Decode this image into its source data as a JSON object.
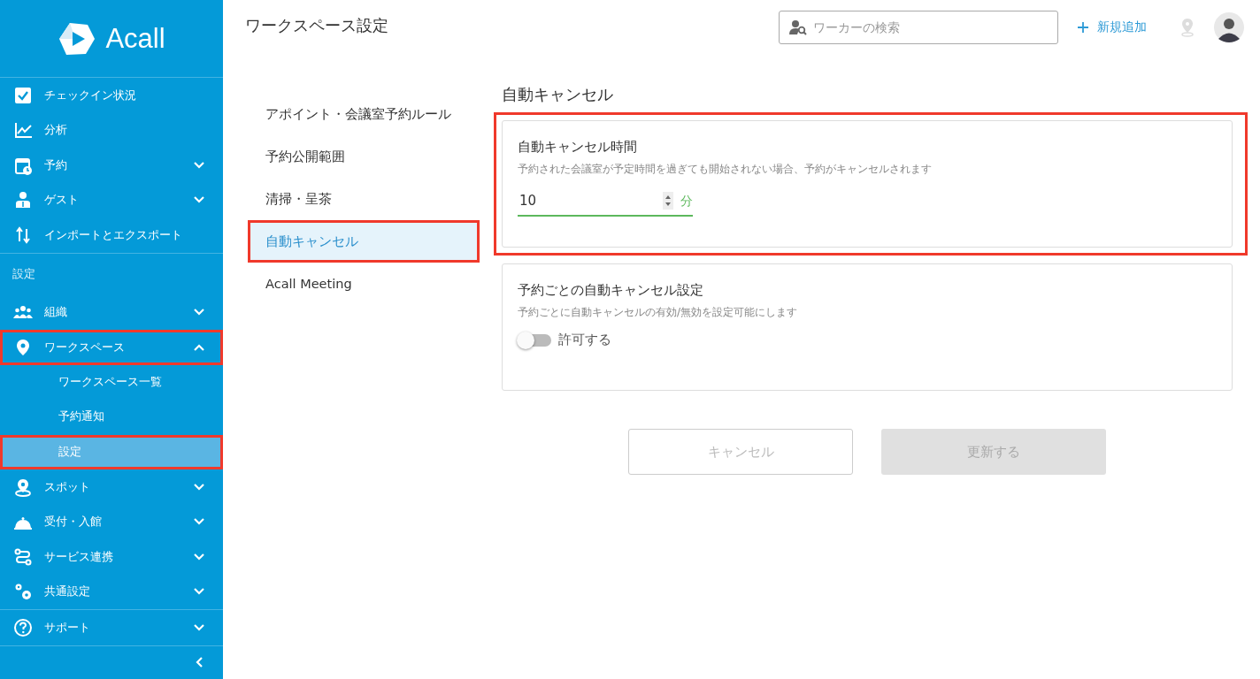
{
  "sidebar": {
    "logo": "Acall",
    "sections": [
      {
        "items": [
          {
            "label": "チェックイン状況",
            "kind": "link",
            "highlighted": false
          },
          {
            "label": "分析",
            "kind": "link",
            "highlighted": false
          },
          {
            "label": "予約",
            "kind": "group",
            "expanded": false,
            "highlighted": false
          },
          {
            "label": "ゲスト",
            "kind": "group",
            "expanded": false,
            "highlighted": false
          },
          {
            "label": "インポートとエクスポート",
            "kind": "link",
            "highlighted": false
          }
        ]
      },
      {
        "heading": "設定",
        "items": [
          {
            "label": "組織",
            "kind": "group",
            "expanded": false,
            "highlighted": false
          },
          {
            "label": "ワークスペース",
            "kind": "group",
            "expanded": true,
            "highlighted": true,
            "children": [
              {
                "label": "ワークスペース一覧",
                "selected": false,
                "highlighted": false
              },
              {
                "label": "予約通知",
                "selected": false,
                "highlighted": false
              },
              {
                "label": "設定",
                "selected": true,
                "highlighted": true
              }
            ]
          },
          {
            "label": "スポット",
            "kind": "group",
            "expanded": false,
            "highlighted": false
          },
          {
            "label": "受付・入館",
            "kind": "group",
            "expanded": false,
            "highlighted": false
          },
          {
            "label": "サービス連携",
            "kind": "group",
            "expanded": false,
            "highlighted": false
          },
          {
            "label": "共通設定",
            "kind": "group",
            "expanded": false,
            "highlighted": false
          }
        ]
      },
      {
        "items": [
          {
            "label": "サポート",
            "kind": "group",
            "expanded": false,
            "highlighted": false
          }
        ]
      }
    ]
  },
  "top_bar": {
    "title": "ワークスペース設定",
    "search": {
      "placeholder": "ワーカーの検索"
    },
    "add_button": "新規追加"
  },
  "settings_menu": {
    "items": [
      {
        "label": "アポイント・会議室予約ルール",
        "selected": false,
        "highlighted": false
      },
      {
        "label": "予約公開範囲",
        "selected": false,
        "highlighted": false
      },
      {
        "label": "清掃・呈茶",
        "selected": false,
        "highlighted": false
      },
      {
        "label": "自動キャンセル",
        "selected": true,
        "highlighted": true
      },
      {
        "label": "Acall Meeting",
        "selected": false,
        "highlighted": false
      }
    ]
  },
  "panel": {
    "title": "自動キャンセル",
    "cards": [
      {
        "kind": "number",
        "title": "自動キャンセル時間",
        "description": "予約された会議室が予定時間を過ぎても開始されない場合、予約がキャンセルされます",
        "value": "10",
        "unit": "分",
        "highlighted": true
      },
      {
        "kind": "toggle",
        "title": "予約ごとの自動キャンセル設定",
        "description": "予約ごとに自動キャンセルの有効/無効を設定可能にします",
        "label": "許可する",
        "on": false,
        "highlighted": false
      }
    ],
    "buttons": [
      {
        "label": "キャンセル",
        "kind": "outline",
        "disabled": true
      },
      {
        "label": "更新する",
        "kind": "filled",
        "disabled": true
      }
    ]
  }
}
